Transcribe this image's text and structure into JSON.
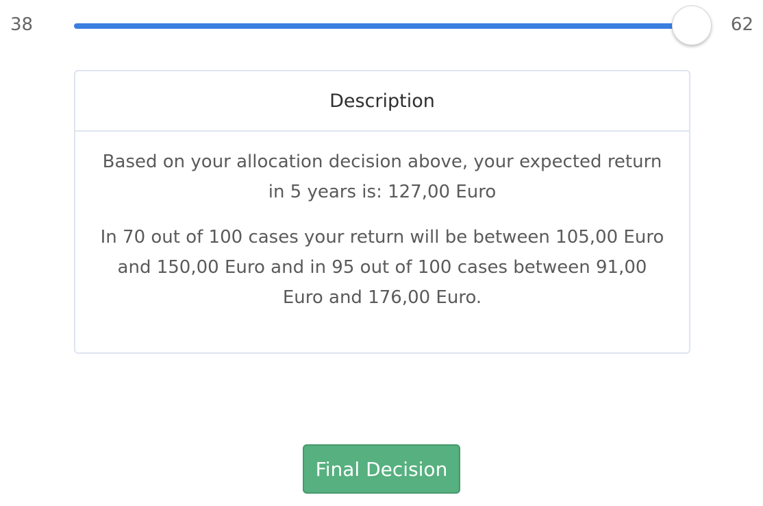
{
  "slider": {
    "min_label": "38",
    "max_label": "62",
    "fill_fraction": 1.0,
    "accent_color": "#3b7fe0"
  },
  "description_card": {
    "title": "Description",
    "expected_return_text": "Based on your allocation decision above, your expected return in 5 years is: 127,00 Euro",
    "range_text": "In 70 out of 100 cases your return will be between 105,00 Euro and 150,00 Euro and in 95 out of 100 cases between 91,00 Euro and 176,00 Euro."
  },
  "actions": {
    "final_decision_label": "Final Decision",
    "button_color": "#56b07f"
  }
}
